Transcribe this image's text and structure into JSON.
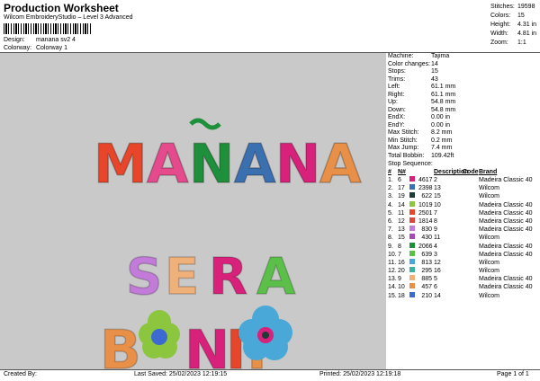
{
  "header": {
    "title": "Production Worksheet",
    "subtitle": "Wilcom EmbroideryStudio – Level 3 Advanced",
    "design_label": "Design:",
    "design_value": "manana sv2 4",
    "colorway_label": "Colorway:",
    "colorway_value": "Colorway 1"
  },
  "summary": [
    {
      "label": "Stitches:",
      "value": "19598"
    },
    {
      "label": "Colors:",
      "value": "15"
    },
    {
      "label": "Height:",
      "value": "4.31 in"
    },
    {
      "label": "Width:",
      "value": "4.81 in"
    },
    {
      "label": "Zoom:",
      "value": "1:1"
    }
  ],
  "design_text": {
    "line1": "MAÑANA",
    "line2": "SERÁ",
    "line3": "BONITO"
  },
  "properties": [
    {
      "label": "Machine:",
      "value": "Tajima"
    },
    {
      "label": "Color changes:",
      "value": "14"
    },
    {
      "label": "Stops:",
      "value": "15"
    },
    {
      "label": "Trims:",
      "value": "43"
    },
    {
      "label": "Left:",
      "value": "61.1 mm"
    },
    {
      "label": "Right:",
      "value": "61.1 mm"
    },
    {
      "label": "Up:",
      "value": "54.8 mm"
    },
    {
      "label": "Down:",
      "value": "54.8 mm"
    },
    {
      "label": "EndX:",
      "value": "0.00 in"
    },
    {
      "label": "EndY:",
      "value": "0.00 in"
    },
    {
      "label": "Max Stitch:",
      "value": "8.2 mm"
    },
    {
      "label": "Min Stitch:",
      "value": "0.2 mm"
    },
    {
      "label": "Max Jump:",
      "value": "7.4 mm"
    },
    {
      "label": "Total Bobbin:",
      "value": "109.42ft"
    }
  ],
  "stop_sequence": {
    "title": "Stop Sequence:",
    "headers": [
      "#",
      "N#",
      "",
      "",
      "Description",
      "Code",
      "Brand"
    ],
    "rows": [
      {
        "n": "1.",
        "nn": "6",
        "color": "#d8217a",
        "stitches": "4617",
        "desc": "2",
        "code": "",
        "brand": "Madeira Classic 40"
      },
      {
        "n": "2.",
        "nn": "17",
        "color": "#3a6fb0",
        "stitches": "2398",
        "desc": "13",
        "code": "",
        "brand": "Wilcom"
      },
      {
        "n": "3.",
        "nn": "19",
        "color": "#1e3b36",
        "stitches": "622",
        "desc": "15",
        "code": "",
        "brand": "Wilcom"
      },
      {
        "n": "4.",
        "nn": "14",
        "color": "#8cc63f",
        "stitches": "1019",
        "desc": "10",
        "code": "",
        "brand": "Madeira Classic 40"
      },
      {
        "n": "5.",
        "nn": "11",
        "color": "#e8462a",
        "stitches": "2501",
        "desc": "7",
        "code": "",
        "brand": "Madeira Classic 40"
      },
      {
        "n": "6.",
        "nn": "12",
        "color": "#e0473a",
        "stitches": "1814",
        "desc": "8",
        "code": "",
        "brand": "Madeira Classic 40"
      },
      {
        "n": "7.",
        "nn": "13",
        "color": "#c27bd8",
        "stitches": "830",
        "desc": "9",
        "code": "",
        "brand": "Madeira Classic 40"
      },
      {
        "n": "8.",
        "nn": "15",
        "color": "#a54ab8",
        "stitches": "430",
        "desc": "11",
        "code": "",
        "brand": "Wilcom"
      },
      {
        "n": "9.",
        "nn": "8",
        "color": "#1e8f3a",
        "stitches": "2066",
        "desc": "4",
        "code": "",
        "brand": "Madeira Classic 40"
      },
      {
        "n": "10.",
        "nn": "7",
        "color": "#5bbf4a",
        "stitches": "639",
        "desc": "3",
        "code": "",
        "brand": "Madeira Classic 40"
      },
      {
        "n": "11.",
        "nn": "16",
        "color": "#4aa8d8",
        "stitches": "813",
        "desc": "12",
        "code": "",
        "brand": "Wilcom"
      },
      {
        "n": "12.",
        "nn": "20",
        "color": "#3bb0a8",
        "stitches": "295",
        "desc": "16",
        "code": "",
        "brand": "Wilcom"
      },
      {
        "n": "13.",
        "nn": "9",
        "color": "#f0b07a",
        "stitches": "885",
        "desc": "5",
        "code": "",
        "brand": "Madeira Classic 40"
      },
      {
        "n": "14.",
        "nn": "10",
        "color": "#e89048",
        "stitches": "457",
        "desc": "6",
        "code": "",
        "brand": "Madeira Classic 40"
      },
      {
        "n": "15.",
        "nn": "18",
        "color": "#3c6ad0",
        "stitches": "210",
        "desc": "14",
        "code": "",
        "brand": "Wilcom"
      }
    ]
  },
  "footer": {
    "created_by": "Created By:",
    "last_saved": "Last Saved: 25/02/2023 12:19:15",
    "printed": "Printed: 25/02/2023 12:19:18",
    "page": "Page 1 of 1"
  }
}
